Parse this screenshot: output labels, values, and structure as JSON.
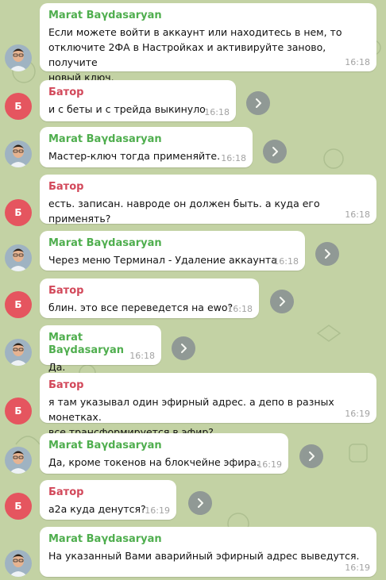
{
  "colors": {
    "background": "#c3d2a4",
    "bubble": "#ffffff",
    "marat_name": "#4fae4e",
    "bator_name": "#d2485a",
    "bator_avatar": "#e5555f",
    "time": "#a3a3a3",
    "forward_button": "#8a9293"
  },
  "messages": [
    {
      "sender": "Marat Baγdasaryan",
      "text": "Если можете войти в аккаунт или находитесь в нем, то\nотключите 2ФА в Настройках и активируйте заново, получите\nновый ключ.",
      "time": "16:18"
    },
    {
      "sender": "Батор",
      "avatar": "Б",
      "text": "и с беты и с трейда выкинуло",
      "time": "16:18"
    },
    {
      "sender": "Marat Baγdasaryan",
      "text": "Мастер-ключ тогда применяйте.",
      "time": "16:18"
    },
    {
      "sender": "Батор",
      "avatar": "Б",
      "text": "есть. записан. навроде он должен быть. а куда его применять?",
      "time": "16:18"
    },
    {
      "sender": "Marat Baγdasaryan",
      "text": "Через меню Терминал - Удаление аккаунта",
      "time": "16:18"
    },
    {
      "sender": "Батор",
      "avatar": "Б",
      "text": "блин. это все переведется на ewo?",
      "time": "16:18"
    },
    {
      "sender": "Marat Baγdasaryan",
      "text": "Да.",
      "time": "16:18"
    },
    {
      "sender": "Батор",
      "avatar": "Б",
      "text": "я там указывал один эфирный адрес. а депо в разных монетках.\nвсе трансформируется в эфир?",
      "time": "16:19"
    },
    {
      "sender": "Marat Baγdasaryan",
      "text": "Да, кроме токенов на блокчейне эфира.",
      "time": "16:19"
    },
    {
      "sender": "Батор",
      "avatar": "Б",
      "text": "а2а куда денутся?",
      "time": "16:19"
    },
    {
      "sender": "Marat Baγdasaryan",
      "text": "На указанный Вами аварийный эфирный адрес выведутся.",
      "time": "16:19"
    }
  ]
}
